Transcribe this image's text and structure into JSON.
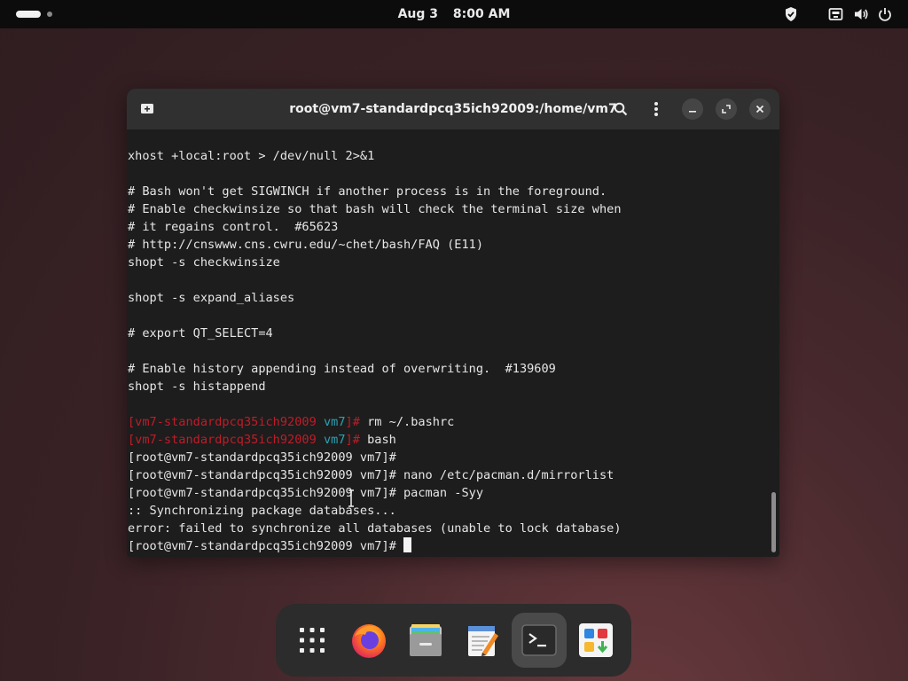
{
  "topbar": {
    "date": "Aug 3",
    "time": "8:00 AM",
    "icons": [
      "workspace-indicator",
      "shield-icon",
      "network-icon",
      "volume-icon",
      "power-icon"
    ]
  },
  "window": {
    "title": "root@vm7-standardpcq35ich92009:/home/vm7",
    "buttons": [
      "new-tab-icon",
      "search-icon",
      "menu-icon",
      "minimize-icon",
      "restore-icon",
      "close-icon"
    ]
  },
  "terminal": {
    "lines": [
      "xhost +local:root > /dev/null 2>&1",
      "",
      "# Bash won't get SIGWINCH if another process is in the foreground.",
      "# Enable checkwinsize so that bash will check the terminal size when",
      "# it regains control.  #65623",
      "# http://cnswww.cns.cwru.edu/~chet/bash/FAQ (E11)",
      "shopt -s checkwinsize",
      "",
      "shopt -s expand_aliases",
      "",
      "# export QT_SELECT=4",
      "",
      "# Enable history appending instead of overwriting.  #139609",
      "shopt -s histappend",
      ""
    ],
    "colored_prompts": [
      {
        "host": "[vm7-standardpcq35ich92009",
        "dir": "vm7",
        "suffix": "]#",
        "command": " rm ~/.bashrc"
      },
      {
        "host": "[vm7-standardpcq35ich92009",
        "dir": "vm7",
        "suffix": "]#",
        "command": " bash"
      }
    ],
    "plain_lines": [
      "[root@vm7-standardpcq35ich92009 vm7]#",
      "[root@vm7-standardpcq35ich92009 vm7]# nano /etc/pacman.d/mirrorlist",
      "[root@vm7-standardpcq35ich92009 vm7]# pacman -Syy",
      ":: Synchronizing package databases...",
      "error: failed to synchronize all databases (unable to lock database)"
    ],
    "last_prompt": "[root@vm7-standardpcq35ich92009 vm7]# "
  },
  "dock": {
    "items": [
      "app-grid-icon",
      "firefox-icon",
      "files-icon",
      "text-editor-icon",
      "terminal-icon",
      "software-icon"
    ],
    "active": "terminal-icon"
  }
}
